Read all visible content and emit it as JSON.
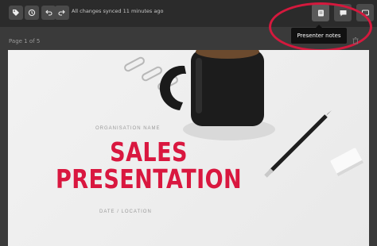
{
  "toolbar": {
    "sync_status": "All changes synced 11 minutes ago",
    "left_icons": [
      "tag-icon",
      "history-icon",
      "undo-icon",
      "redo-icon"
    ],
    "right_icons": [
      "presenter-notes-icon",
      "comment-icon",
      "present-icon"
    ]
  },
  "tooltip": {
    "text": "Presenter notes"
  },
  "page_info": "Page 1 of 5",
  "slide": {
    "org": "ORGANISATION NAME",
    "title_line1": "SALES",
    "title_line2": "PRESENTATION",
    "date_location": "DATE / LOCATION"
  },
  "colors": {
    "accent": "#d9173f",
    "highlight": "#d4193d",
    "toolbar_bg": "#2b2b2b"
  }
}
